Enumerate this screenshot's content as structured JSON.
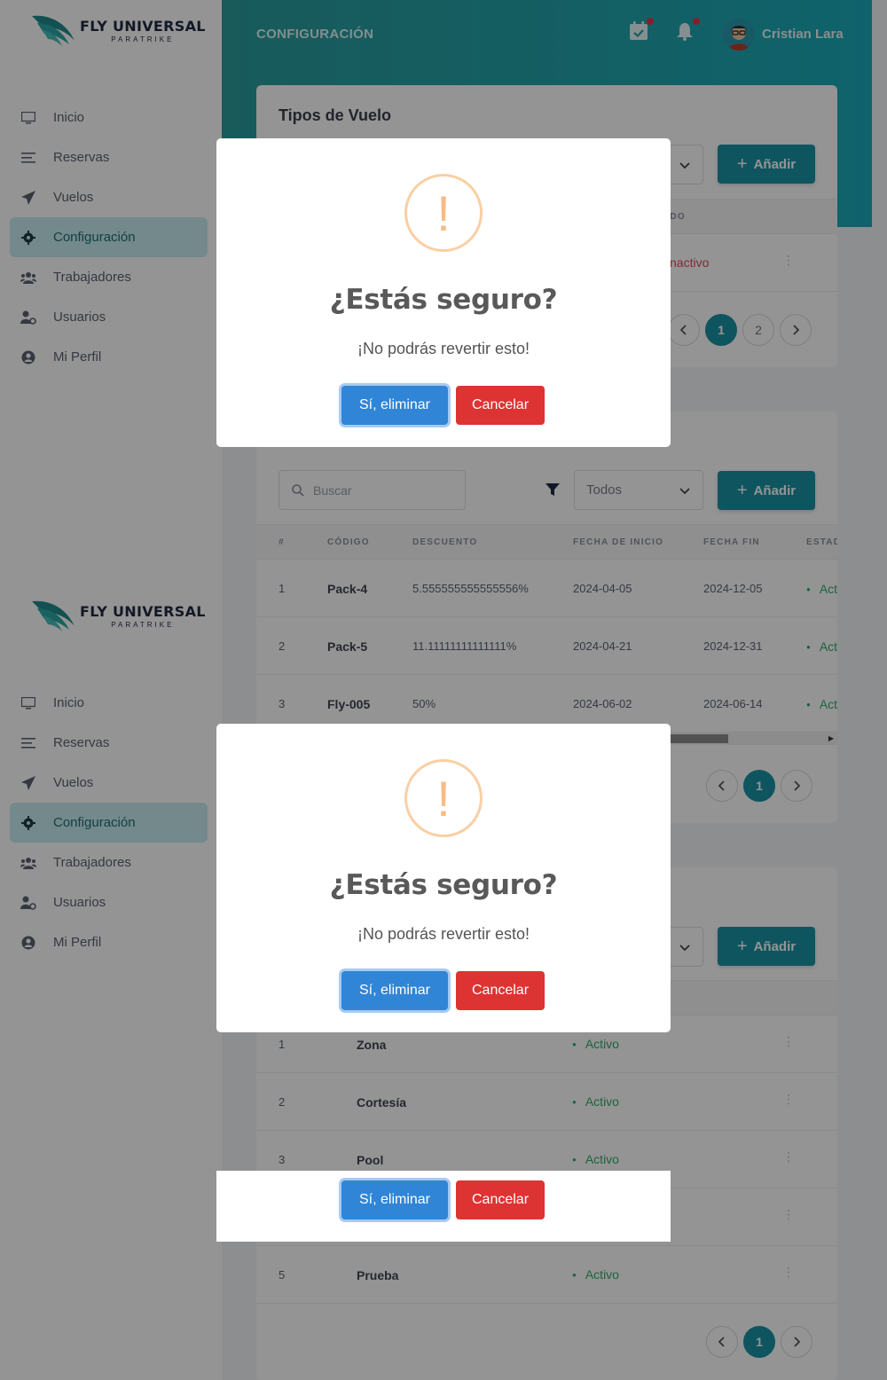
{
  "brand": {
    "name": "FLY UNIVERSAL",
    "tagline": "PARATRIKE"
  },
  "sidebar": {
    "items": [
      {
        "label": "Inicio",
        "icon": "monitor-icon"
      },
      {
        "label": "Reservas",
        "icon": "list-icon"
      },
      {
        "label": "Vuelos",
        "icon": "paper-plane-icon"
      },
      {
        "label": "Configuración",
        "icon": "gear-icon",
        "active": true
      },
      {
        "label": "Trabajadores",
        "icon": "users-icon"
      },
      {
        "label": "Usuarios",
        "icon": "user-cog-icon"
      },
      {
        "label": "Mi Perfil",
        "icon": "user-circle-icon"
      }
    ]
  },
  "header": {
    "title": "CONFIGURACIÓN",
    "user_name": "Cristian Lara"
  },
  "flight_types": {
    "title": "Tipos de Vuelo",
    "add_label": "Añadir",
    "column_partial": "ADO",
    "row_status_partial": "nactivo",
    "pages": [
      "1",
      "2"
    ]
  },
  "discounts": {
    "search_placeholder": "Buscar",
    "filter_value": "Todos",
    "add_label": "Añadir",
    "columns": [
      "#",
      "CÓDIGO",
      "DESCUENTO",
      "FECHA DE INICIO",
      "FECHA FIN",
      "ESTAD"
    ],
    "rows": [
      {
        "n": "1",
        "code": "Pack-4",
        "discount": "5.555555555555556%",
        "start": "2024-04-05",
        "end": "2024-12-05",
        "status": "Act"
      },
      {
        "n": "2",
        "code": "Pack-5",
        "discount": "11.11111111111111%",
        "start": "2024-04-21",
        "end": "2024-12-31",
        "status": "Act"
      },
      {
        "n": "3",
        "code": "Fly-005",
        "discount": "50%",
        "start": "2024-06-02",
        "end": "2024-06-14",
        "status": "Act"
      }
    ],
    "pages": [
      "1"
    ]
  },
  "third_table": {
    "add_label": "Añadir",
    "rows": [
      {
        "n": "1",
        "name": "Zona",
        "status": "Activo"
      },
      {
        "n": "2",
        "name": "Cortesía",
        "status": "Activo"
      },
      {
        "n": "3",
        "name": "Pool",
        "status": "Activo"
      },
      {
        "n": "5",
        "name": "Prueba",
        "status": "Activo"
      }
    ],
    "pages": [
      "1"
    ]
  },
  "dialog": {
    "icon_glyph": "!",
    "title": "¿Estás seguro?",
    "text": "¡No podrás revertir esto!",
    "confirm_label": "Sí, eliminar",
    "cancel_label": "Cancelar"
  },
  "colors": {
    "accent": "#1b93a5",
    "confirm": "#3085d6",
    "cancel": "#dd3333",
    "warning": "#f8bb86"
  }
}
